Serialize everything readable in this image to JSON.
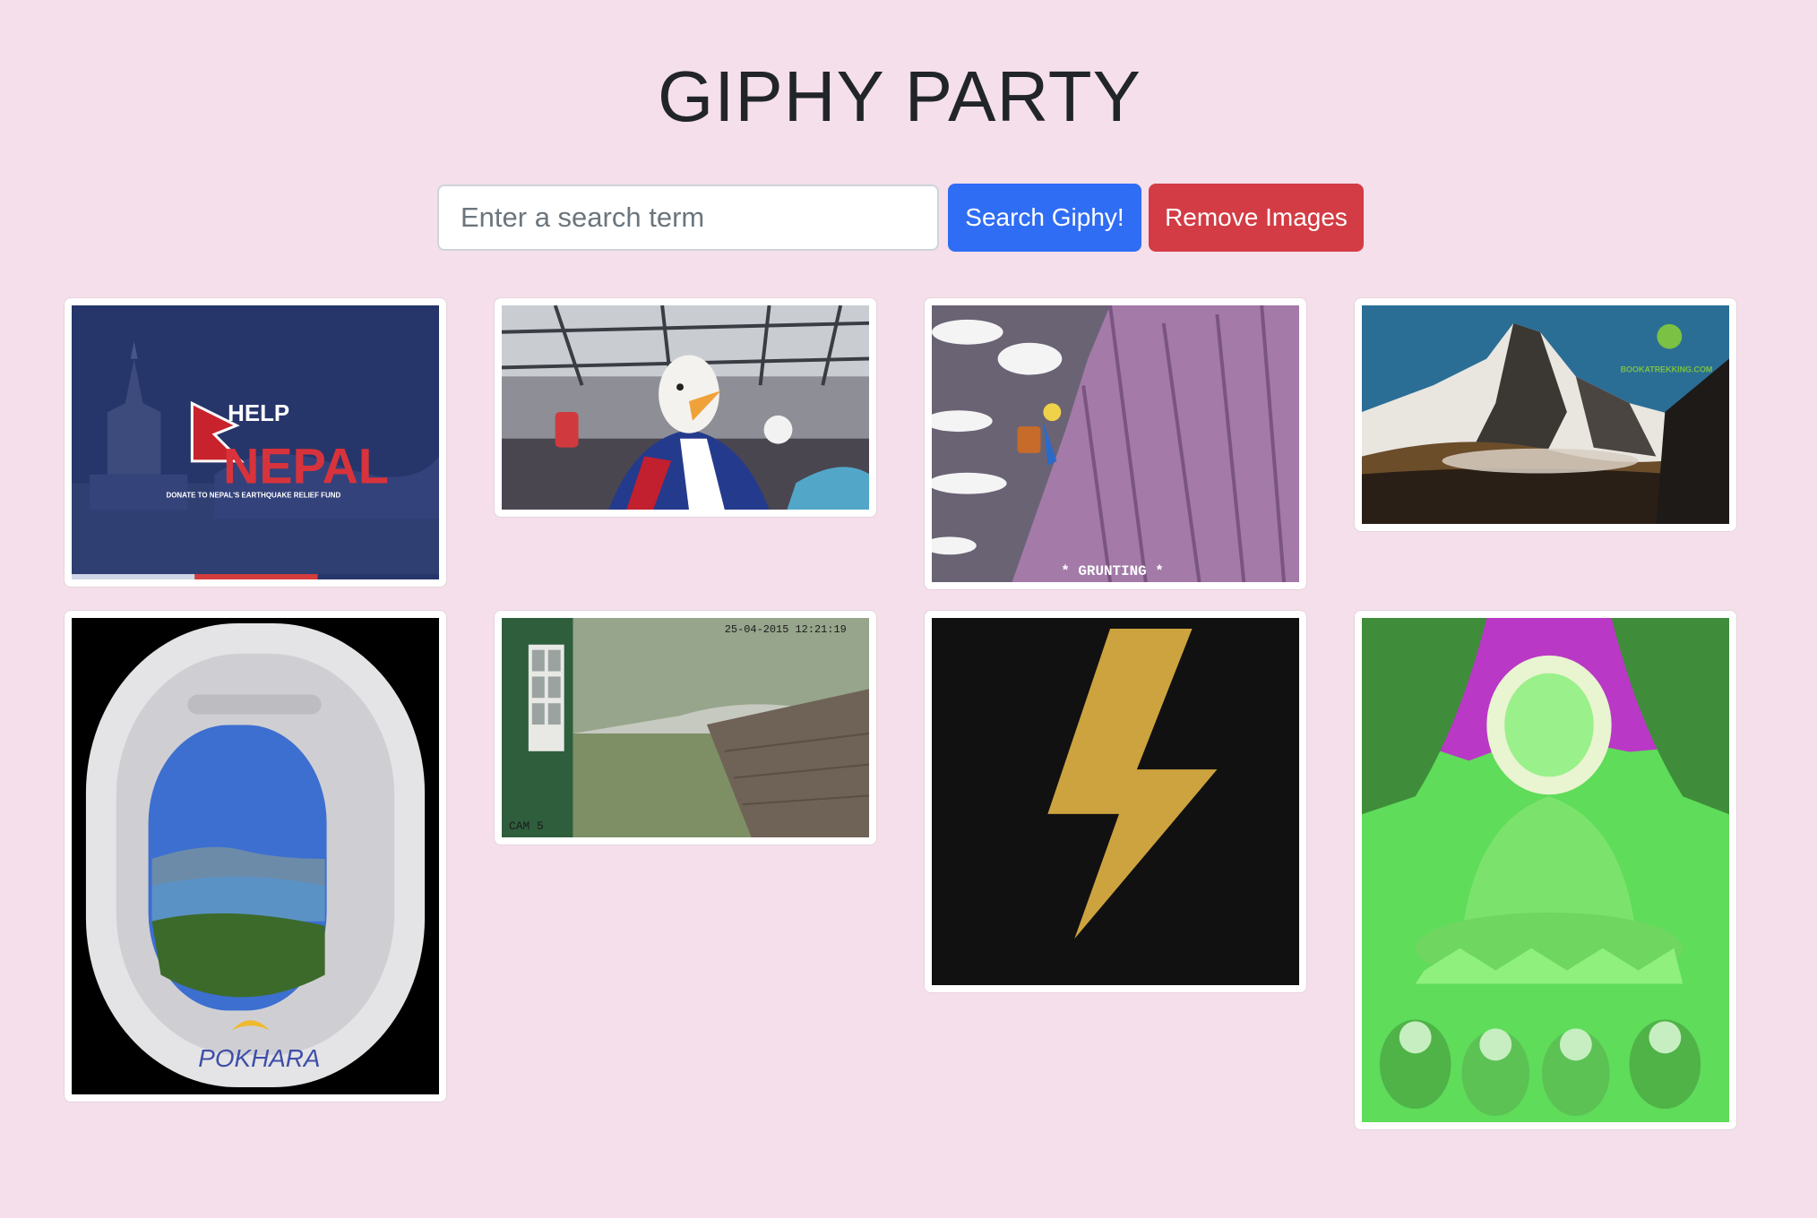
{
  "title": "GIPHY PARTY",
  "search": {
    "placeholder": "Enter a search term",
    "value": ""
  },
  "buttons": {
    "search_label": "Search Giphy!",
    "remove_label": "Remove Images"
  },
  "colors": {
    "background": "#f5dfea",
    "search_button": "#2f6df4",
    "remove_button": "#d33c44"
  },
  "gifs": {
    "nepal": {
      "line1": "HELP",
      "line2": "NEPAL",
      "caption": "DONATE TO NEPAL'S EARTHQUAKE RELIEF FUND"
    },
    "eagle": {},
    "climb": {
      "caption": "* GRUNTING *"
    },
    "everest": {
      "watermark": "BOOKATREKKING.COM"
    },
    "pokhara": {
      "caption": "POKHARA"
    },
    "cctv": {
      "timestamp": "25-04-2015 12:21:19",
      "camera": "CAM 5"
    },
    "bolt": {},
    "buddha": {}
  }
}
